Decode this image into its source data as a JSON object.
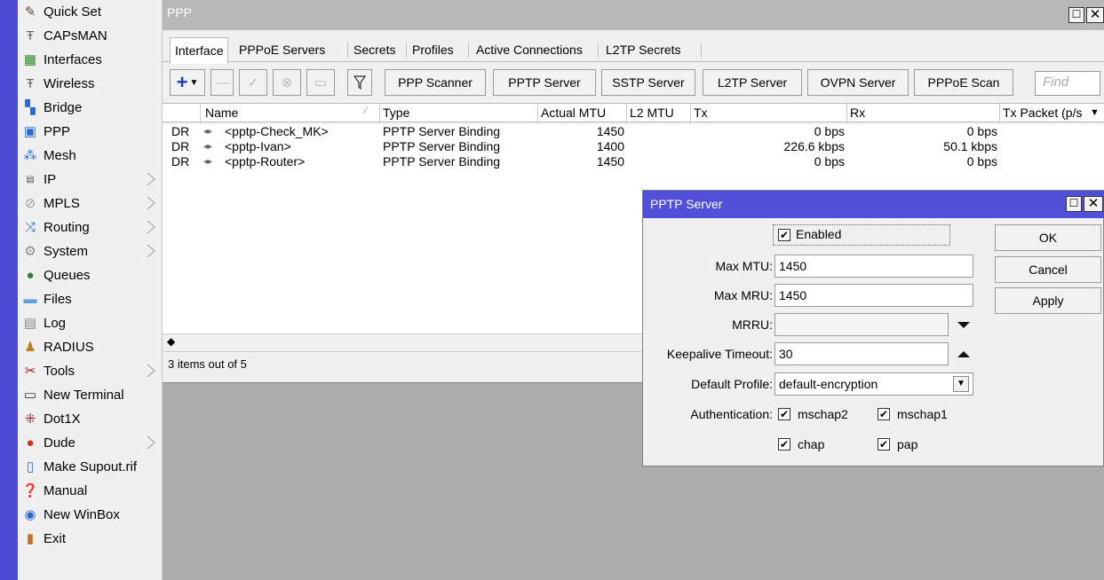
{
  "sidebar": {
    "items": [
      {
        "label": "Quick Set",
        "icon": "wand-icon",
        "submenu": false
      },
      {
        "label": "CAPsMAN",
        "icon": "antenna-icon",
        "submenu": false
      },
      {
        "label": "Interfaces",
        "icon": "interfaces-icon",
        "submenu": false
      },
      {
        "label": "Wireless",
        "icon": "antenna-icon",
        "submenu": false
      },
      {
        "label": "Bridge",
        "icon": "bridge-icon",
        "submenu": false
      },
      {
        "label": "PPP",
        "icon": "ppp-icon",
        "submenu": false
      },
      {
        "label": "Mesh",
        "icon": "mesh-icon",
        "submenu": false
      },
      {
        "label": "IP",
        "icon": "ip-icon",
        "submenu": true
      },
      {
        "label": "MPLS",
        "icon": "mpls-icon",
        "submenu": true
      },
      {
        "label": "Routing",
        "icon": "routing-icon",
        "submenu": true
      },
      {
        "label": "System",
        "icon": "gear-icon",
        "submenu": true
      },
      {
        "label": "Queues",
        "icon": "queues-icon",
        "submenu": false
      },
      {
        "label": "Files",
        "icon": "folder-icon",
        "submenu": false
      },
      {
        "label": "Log",
        "icon": "log-icon",
        "submenu": false
      },
      {
        "label": "RADIUS",
        "icon": "users-icon",
        "submenu": false
      },
      {
        "label": "Tools",
        "icon": "tools-icon",
        "submenu": true
      },
      {
        "label": "New Terminal",
        "icon": "terminal-icon",
        "submenu": false
      },
      {
        "label": "Dot1X",
        "icon": "dot1x-icon",
        "submenu": false
      },
      {
        "label": "Dude",
        "icon": "dude-icon",
        "submenu": true
      },
      {
        "label": "Make Supout.rif",
        "icon": "document-icon",
        "submenu": false
      },
      {
        "label": "Manual",
        "icon": "help-icon",
        "submenu": false
      },
      {
        "label": "New WinBox",
        "icon": "winbox-icon",
        "submenu": false
      },
      {
        "label": "Exit",
        "icon": "exit-icon",
        "submenu": false
      }
    ]
  },
  "ppp": {
    "title": "PPP",
    "tabs": [
      "Interface",
      "PPPoE Servers",
      "Secrets",
      "Profiles",
      "Active Connections",
      "L2TP Secrets"
    ],
    "toolbar": {
      "buttons": [
        "PPP Scanner",
        "PPTP Server",
        "SSTP Server",
        "L2TP Server",
        "OVPN Server",
        "PPPoE Scan"
      ],
      "find_placeholder": "Find"
    },
    "table": {
      "columns": [
        "Name",
        "Type",
        "Actual MTU",
        "L2 MTU",
        "Tx",
        "Rx",
        "Tx Packet (p/s"
      ],
      "rows": [
        {
          "flags": "DR",
          "name": "<pptp-Check_MK>",
          "type": "PPTP Server Binding",
          "actual_mtu": "1450",
          "l2_mtu": "",
          "tx": "0 bps",
          "rx": "0 bps"
        },
        {
          "flags": "DR",
          "name": "<pptp-Ivan>",
          "type": "PPTP Server Binding",
          "actual_mtu": "1400",
          "l2_mtu": "",
          "tx": "226.6 kbps",
          "rx": "50.1 kbps"
        },
        {
          "flags": "DR",
          "name": "<pptp-Router>",
          "type": "PPTP Server Binding",
          "actual_mtu": "1450",
          "l2_mtu": "",
          "tx": "0 bps",
          "rx": "0 bps"
        }
      ]
    },
    "status": "3 items out of 5"
  },
  "dialog": {
    "title": "PPTP Server",
    "enabled_label": "Enabled",
    "enabled": true,
    "max_mtu_label": "Max MTU:",
    "max_mtu": "1450",
    "max_mru_label": "Max MRU:",
    "max_mru": "1450",
    "mrru_label": "MRRU:",
    "mrru": "",
    "keepalive_label": "Keepalive Timeout:",
    "keepalive": "30",
    "profile_label": "Default Profile:",
    "profile": "default-encryption",
    "auth_label": "Authentication:",
    "auth": [
      {
        "label": "mschap2",
        "checked": true
      },
      {
        "label": "mschap1",
        "checked": true
      },
      {
        "label": "chap",
        "checked": true
      },
      {
        "label": "pap",
        "checked": true
      }
    ],
    "buttons": {
      "ok": "OK",
      "cancel": "Cancel",
      "apply": "Apply"
    }
  },
  "colors": {
    "accent": "#5050d8",
    "side_strip": "#4a4ad0",
    "ppp_title_bg": "#b9b9b9",
    "workspace": "#acacac"
  }
}
